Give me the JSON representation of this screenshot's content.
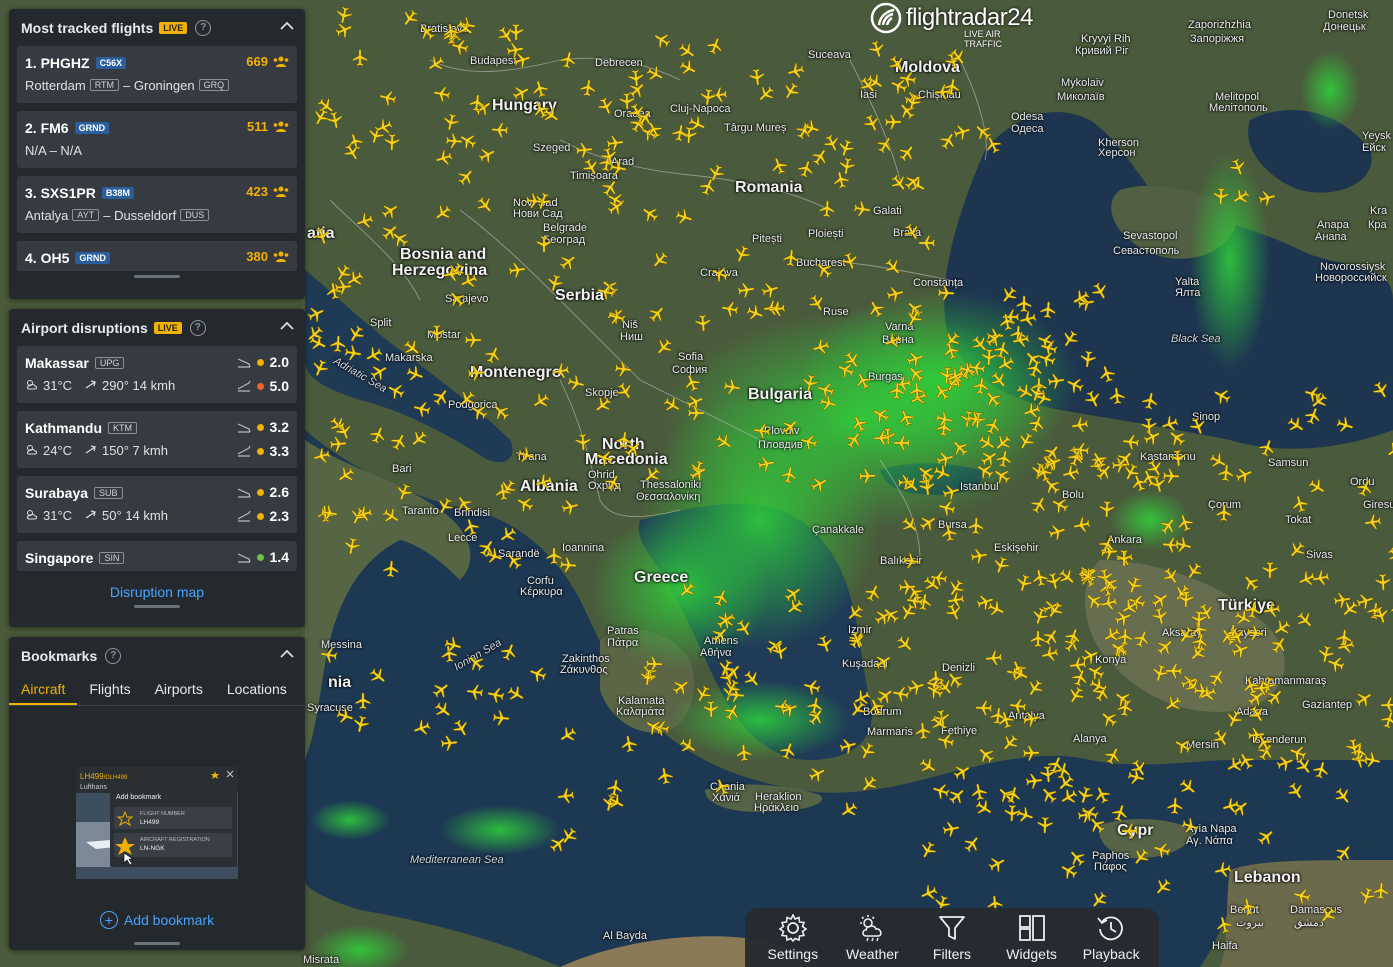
{
  "logo": {
    "brand": "flightradar24",
    "tagline": "LIVE AIR TRAFFIC"
  },
  "most_tracked": {
    "title": "Most tracked flights",
    "live_badge": "LIVE",
    "flights": [
      {
        "rank_callsign": "1. PHGHZ",
        "type": "C56X",
        "count": "669",
        "from": "Rotterdam",
        "from_code": "RTM",
        "to": "Groningen",
        "to_code": "GRQ"
      },
      {
        "rank_callsign": "2. FM6",
        "type": "GRND",
        "count": "511",
        "route_text": "N/A – N/A"
      },
      {
        "rank_callsign": "3. SXS1PR",
        "type": "B38M",
        "count": "423",
        "from": "Antalya",
        "from_code": "AYT",
        "to": "Dusseldorf",
        "to_code": "DUS"
      },
      {
        "rank_callsign": "4. OH5",
        "type": "GRND",
        "count": "380"
      }
    ]
  },
  "disruptions": {
    "title": "Airport disruptions",
    "live_badge": "LIVE",
    "airports": [
      {
        "name": "Makassar",
        "code": "UPG",
        "temp": "31°C",
        "wind": "290° 14 kmh",
        "arr": "2.0",
        "dep": "5.0",
        "arr_color": "#f2b000",
        "dep_color": "#f0662b"
      },
      {
        "name": "Kathmandu",
        "code": "KTM",
        "temp": "24°C",
        "wind": "150° 7 kmh",
        "arr": "3.2",
        "dep": "3.3",
        "arr_color": "#f2b000",
        "dep_color": "#f2b000"
      },
      {
        "name": "Surabaya",
        "code": "SUB",
        "temp": "31°C",
        "wind": "50° 14 kmh",
        "arr": "2.6",
        "dep": "2.3",
        "arr_color": "#f2b000",
        "dep_color": "#f2b000"
      },
      {
        "name": "Singapore",
        "code": "SIN",
        "arr": "1.4",
        "arr_color": "#6cc04a"
      }
    ],
    "link": "Disruption map"
  },
  "bookmarks": {
    "title": "Bookmarks",
    "tabs": [
      "Aircraft",
      "Flights",
      "Airports",
      "Locations"
    ],
    "active_tab": "Aircraft",
    "preview": {
      "flight": "LH499",
      "flight_sub": "/DLH499",
      "airline": "Lufthans",
      "menu_title": "Add bookmark",
      "opt1_label": "FLIGHT NUMBER",
      "opt1_value": "LH499",
      "opt2_label": "AIRCRAFT REGISTRATION",
      "opt2_value": "LN-NGK"
    },
    "add_label": "Add bookmark"
  },
  "toolbar": {
    "items": [
      {
        "label": "Settings",
        "icon": "gear-icon"
      },
      {
        "label": "Weather",
        "icon": "weather-icon"
      },
      {
        "label": "Filters",
        "icon": "filter-icon"
      },
      {
        "label": "Widgets",
        "icon": "widgets-icon"
      },
      {
        "label": "Playback",
        "icon": "playback-icon"
      }
    ]
  },
  "map": {
    "countries": [
      "Moldova",
      "Hungary",
      "Romania",
      "Bosnia and",
      "Herzegovina",
      "Serbia",
      "Montenegro",
      "Bulgaria",
      "North",
      "Macedonia",
      "Albania",
      "Greece",
      "Türkiye",
      "Cypr",
      "Lebanon",
      "atia",
      "nia"
    ],
    "cities": [
      "Budapest",
      "Bratislava",
      "Debrecen",
      "Oradea",
      "Cluj-Napoca",
      "Târgu Mureș",
      "Suceava",
      "Iasi",
      "Chișinău",
      "Szeged",
      "Timișoara",
      "Arad",
      "Novi Sad",
      "Нови Сад",
      "Belgrade",
      "Београд",
      "Sarajevo",
      "Split",
      "Mostar",
      "Niš",
      "Ниш",
      "Sofia",
      "София",
      "Plovdiv",
      "Пловдив",
      "Skopje",
      "Ohrid",
      "Охрид",
      "Thessaloniki",
      "Θεσσαλονίκη",
      "Tirana",
      "Podgorica",
      "Bari",
      "Taranto",
      "Brindisi",
      "Lecce",
      "Corfu",
      "Κέρκυρα",
      "Ioannina",
      "Patras",
      "Πάτρα",
      "Zakinthos",
      "Ζάκυνθος",
      "Kalamata",
      "Καλαμάτα",
      "Athens",
      "Αθήνα",
      "Chania",
      "Χανιά",
      "Heraklion",
      "Ηράκλειο",
      "Izmir",
      "Kuşadası",
      "Bodrum",
      "Marmaris",
      "Fethiye",
      "Denizli",
      "Antalya",
      "Alanya",
      "Konya",
      "Aksaray",
      "Kayseri",
      "Ankara",
      "Eskişehir",
      "Bursa",
      "Balıkesir",
      "Çanakkale",
      "Istanbul",
      "Bolu",
      "Kastamonu",
      "Çorum",
      "Tokat",
      "Samsun",
      "Sivas",
      "Kahramanmaraş",
      "Gaziantep",
      "Adana",
      "Mersin",
      "İskenderun",
      "Giresun",
      "Ordu",
      "Sinop",
      "Varna",
      "Варна",
      "Burgas",
      "Constanța",
      "Galati",
      "Braila",
      "Ploiești",
      "Pitești",
      "Bucharest",
      "Craiova",
      "Ruse",
      "Odesa",
      "Одеса",
      "Mykolaiv",
      "Миколаїв",
      "Kryvyi Rih",
      "Кривий Ріг",
      "Zaporizhzhia",
      "Запоріжжя",
      "Donetsk",
      "Донецьк",
      "Melitopol",
      "Мелітополь",
      "Kherson",
      "Херсон",
      "Sevastopol",
      "Севастополь",
      "Yalta",
      "Ялта",
      "Anapa",
      "Анапа",
      "Novorossiysk",
      "Новороссийск",
      "Yeysk",
      "Ейск",
      "Kra",
      "Кра",
      "Messina",
      "Syracuse",
      "Paphos",
      "Πάφος",
      "Ayia Napa",
      "Αγ. Νάπα",
      "Beirut",
      "بيروت",
      "Damascus",
      "دمشق",
      "Haifa",
      "Al Bayda",
      "Misrata",
      "Makarska",
      "Sarandë"
    ],
    "seas": [
      "Black Sea",
      "Adriatic Sea",
      "Ionian Sea",
      "Mediterranean Sea"
    ]
  }
}
